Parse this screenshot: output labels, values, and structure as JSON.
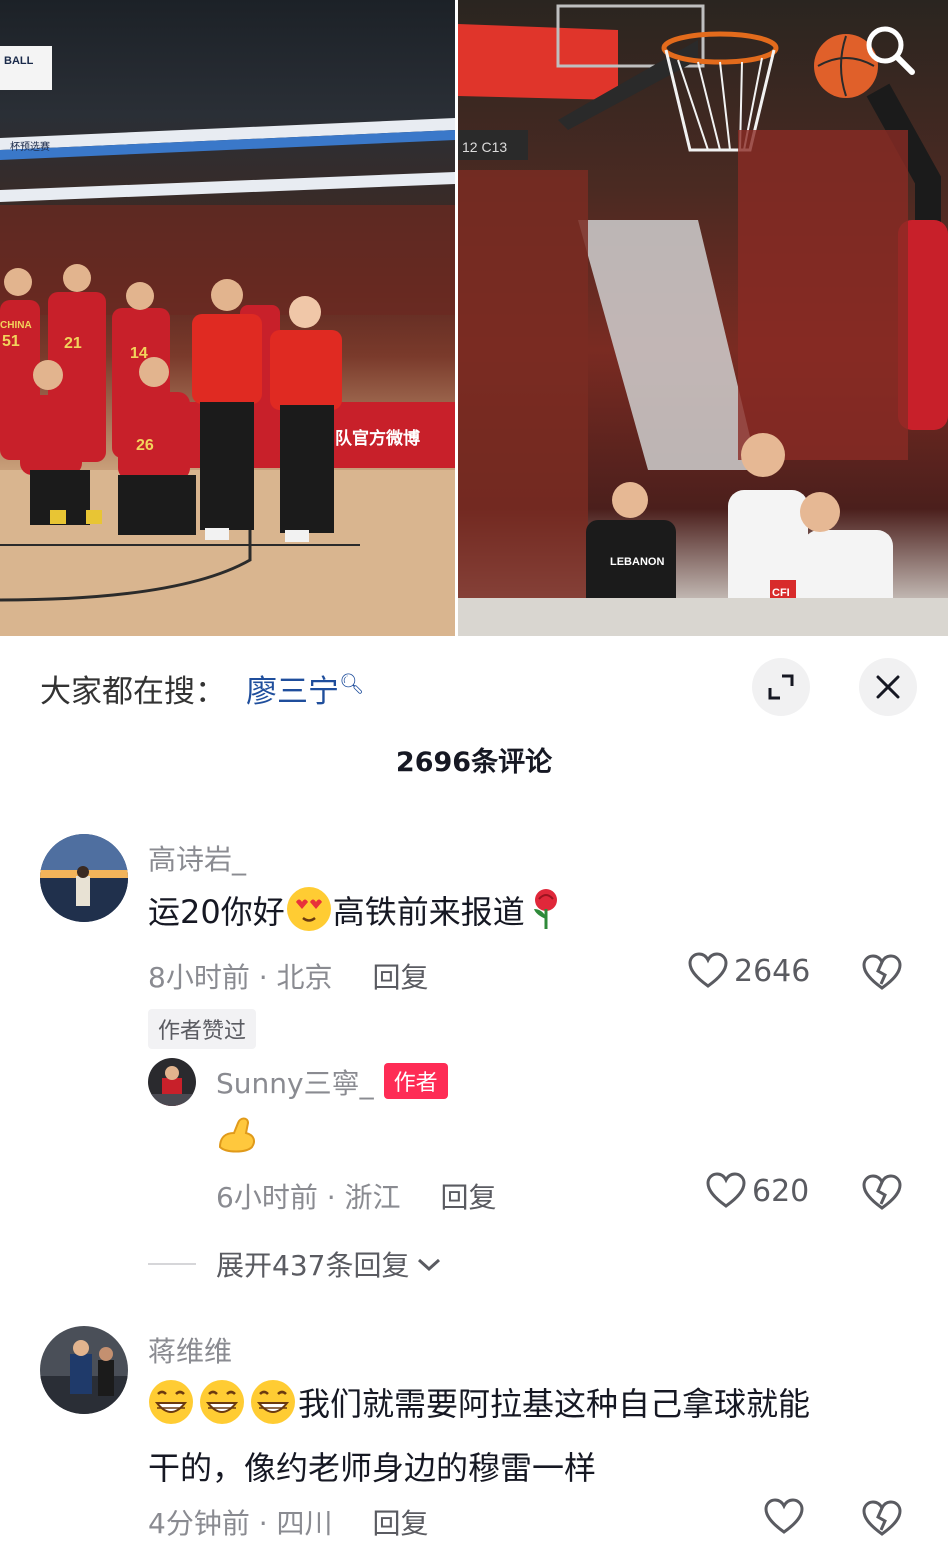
{
  "photos": {
    "left_banner_text": "杯预选赛",
    "left_sign_text": "队官方微博",
    "left_logo_text": "BALL",
    "right_section_text": "12  C13",
    "jerseys": [
      "51",
      "21",
      "14",
      "26"
    ],
    "jersey_word": "CHINA",
    "opponent_word": "LEBANON",
    "opponent_sponsor": "CFI"
  },
  "hot_search": {
    "label": "大家都在搜：",
    "keyword": "廖三宁"
  },
  "comments_title": "2696条评论",
  "comments": [
    {
      "username": "高诗岩_",
      "text_before": "运20你好",
      "text_after": "高铁前来报道",
      "time": "8小时前",
      "location": "北京",
      "reply_label": "回复",
      "likes": "2646",
      "author_liked": "作者赞过",
      "reply": {
        "username": "Sunny三寧_",
        "badge": "作者",
        "text": "💪",
        "time": "6小时前",
        "location": "浙江",
        "reply_label": "回复",
        "likes": "620"
      },
      "expand_label": "展开437条回复"
    },
    {
      "username": "蒋维维",
      "text_line1": "我们就需要阿拉基这种自己拿球就能",
      "text_line2": "干的，像约老师身边的穆雷一样",
      "time": "4分钟前",
      "location": "四川",
      "reply_label": "回复"
    }
  ],
  "colors": {
    "accent_red": "#fe2c55",
    "link_blue": "#1f4e9c",
    "jersey_red": "#c8202a"
  }
}
